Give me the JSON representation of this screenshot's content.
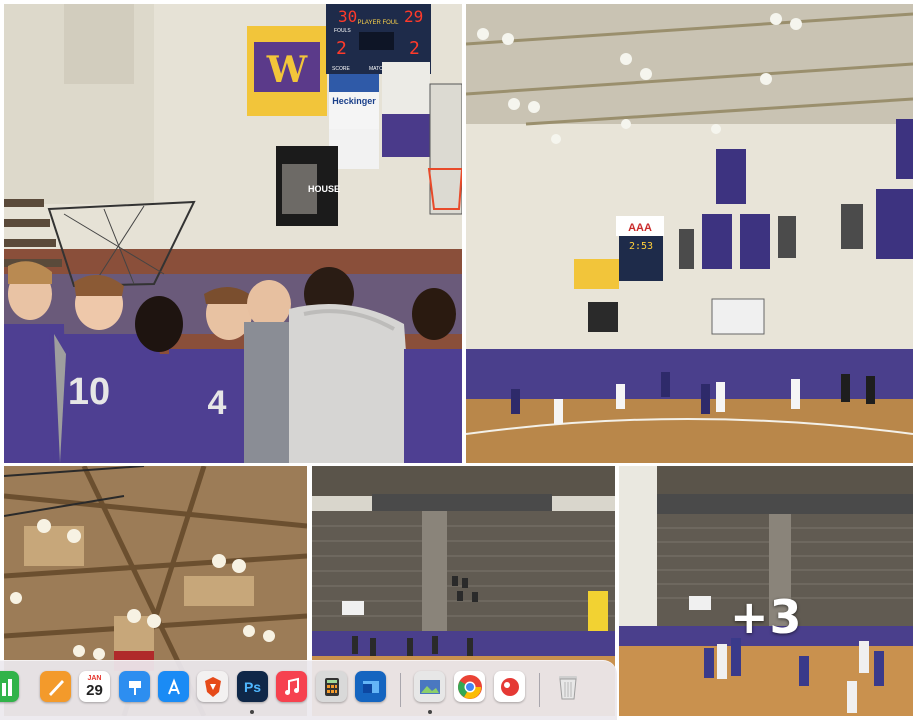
{
  "gallery": {
    "more_count_label": "+3",
    "photos": [
      {
        "alt": "team-huddle-photo"
      },
      {
        "alt": "game-action-photo"
      },
      {
        "alt": "gym-ceiling-photo"
      },
      {
        "alt": "bleachers-wide-photo"
      },
      {
        "alt": "bleachers-game-photo"
      }
    ]
  },
  "scoreboard": {
    "home_score": "30",
    "guest_score": "29",
    "home_fouls": "2",
    "guest_fouls": "2",
    "player_foul_label": "PLAYER FOUL",
    "fouls_label": "FOULS",
    "score_label": "SCORE",
    "match_label": "MATCH"
  },
  "jerseys": {
    "player_a": "10",
    "player_b": "4"
  },
  "signs": {
    "heckinger": "Heckinger",
    "house": "HOUSE",
    "aaa": "AAA",
    "clock_small": "2:53"
  },
  "calendar": {
    "month": "JAN",
    "day": "29"
  },
  "dock": {
    "apps": [
      {
        "name": "Numbers",
        "icon": "numbers-icon"
      },
      {
        "name": "Pages",
        "icon": "pages-icon"
      },
      {
        "name": "Calendar",
        "icon": "calendar-icon"
      },
      {
        "name": "Keynote",
        "icon": "keynote-icon"
      },
      {
        "name": "App Store",
        "icon": "app-store-icon"
      },
      {
        "name": "Brave",
        "icon": "brave-icon"
      },
      {
        "name": "Photoshop",
        "label": "Ps",
        "icon": "photoshop-icon"
      },
      {
        "name": "Music",
        "icon": "music-icon"
      },
      {
        "name": "Calculator",
        "icon": "calculator-icon"
      },
      {
        "name": "Outlook",
        "icon": "outlook-icon"
      },
      {
        "name": "Preview",
        "icon": "preview-icon"
      },
      {
        "name": "Chrome",
        "icon": "chrome-icon"
      },
      {
        "name": "Photo Booth",
        "icon": "photo-booth-icon"
      },
      {
        "name": "Trash",
        "icon": "trash-icon"
      }
    ]
  },
  "colors": {
    "jersey_purple": "#4b3c8f",
    "court_wood": "#b9874a",
    "gym_wall": "#e8e4d8",
    "banner_purple": "#3d3380"
  }
}
